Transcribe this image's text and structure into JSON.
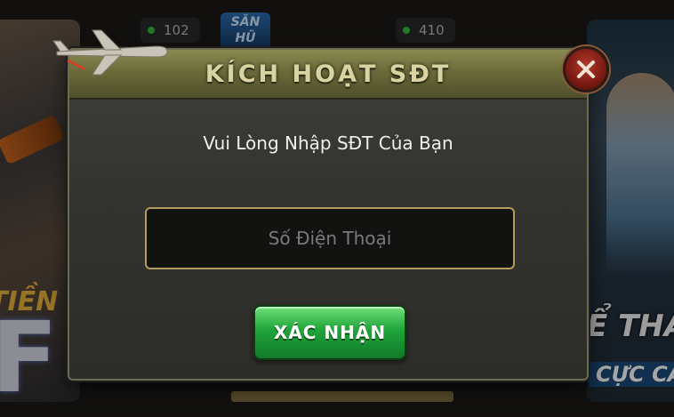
{
  "background": {
    "badge_left": "102",
    "badge_right": "410",
    "mid_card_text": "SĂN HŨ",
    "left_card_text": "TIỀN",
    "left_card_big_letter": "F",
    "right_card_text": "Ể THA",
    "right_card_subtext": "CỰC CA"
  },
  "dialog": {
    "title": "KÍCH HOẠT SĐT",
    "subtitle": "Vui Lòng Nhập SĐT Của Bạn",
    "phone_placeholder": "Số Điện Thoại",
    "phone_value": "",
    "confirm_label": "XÁC NHẬN",
    "close_icon": "close-icon",
    "decor_icon": "airplane-icon"
  },
  "colors": {
    "header": "#6b6b3a",
    "title_text": "#d8d3a0",
    "confirm_green": "#1fa43a",
    "close_red": "#7a1a12",
    "input_border": "#b59b5c"
  }
}
